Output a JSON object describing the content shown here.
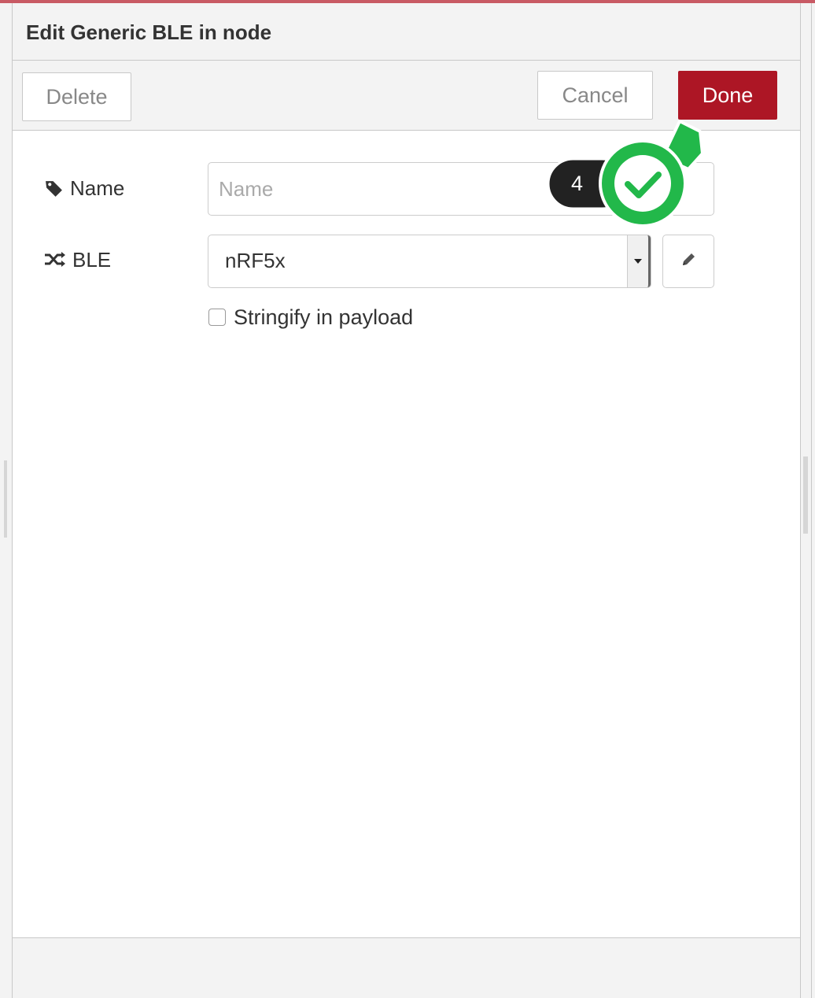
{
  "dialog": {
    "title": "Edit Generic BLE in node"
  },
  "toolbar": {
    "delete_label": "Delete",
    "cancel_label": "Cancel",
    "done_label": "Done",
    "done_color": "#ad1625"
  },
  "form": {
    "name": {
      "label": "Name",
      "icon": "tag-icon",
      "placeholder": "Name",
      "value": ""
    },
    "ble": {
      "label": "BLE",
      "icon": "shuffle-icon",
      "selected": "nRF5x",
      "edit_icon": "pencil-icon"
    },
    "stringify": {
      "label": "Stringify in payload",
      "checked": false
    }
  },
  "tour": {
    "step_badge": "4",
    "pointer_icon": "checkmark-icon",
    "pointer_color": "#22b84a"
  }
}
